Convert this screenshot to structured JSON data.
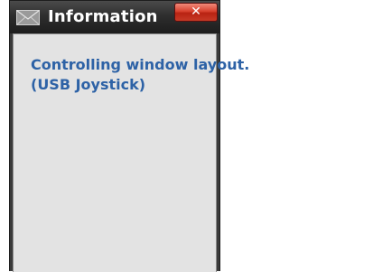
{
  "dialog": {
    "title": "Information",
    "title_icon": "envelope-icon",
    "close_label": "✕",
    "message_lines": [
      "Controlling window layout.",
      "(USB Joystick)"
    ]
  },
  "colors": {
    "titlebar": "#2e2e2e",
    "client_background": "#e3e3e3",
    "message_text": "#2d62a6",
    "close_button": "#d8412e"
  }
}
